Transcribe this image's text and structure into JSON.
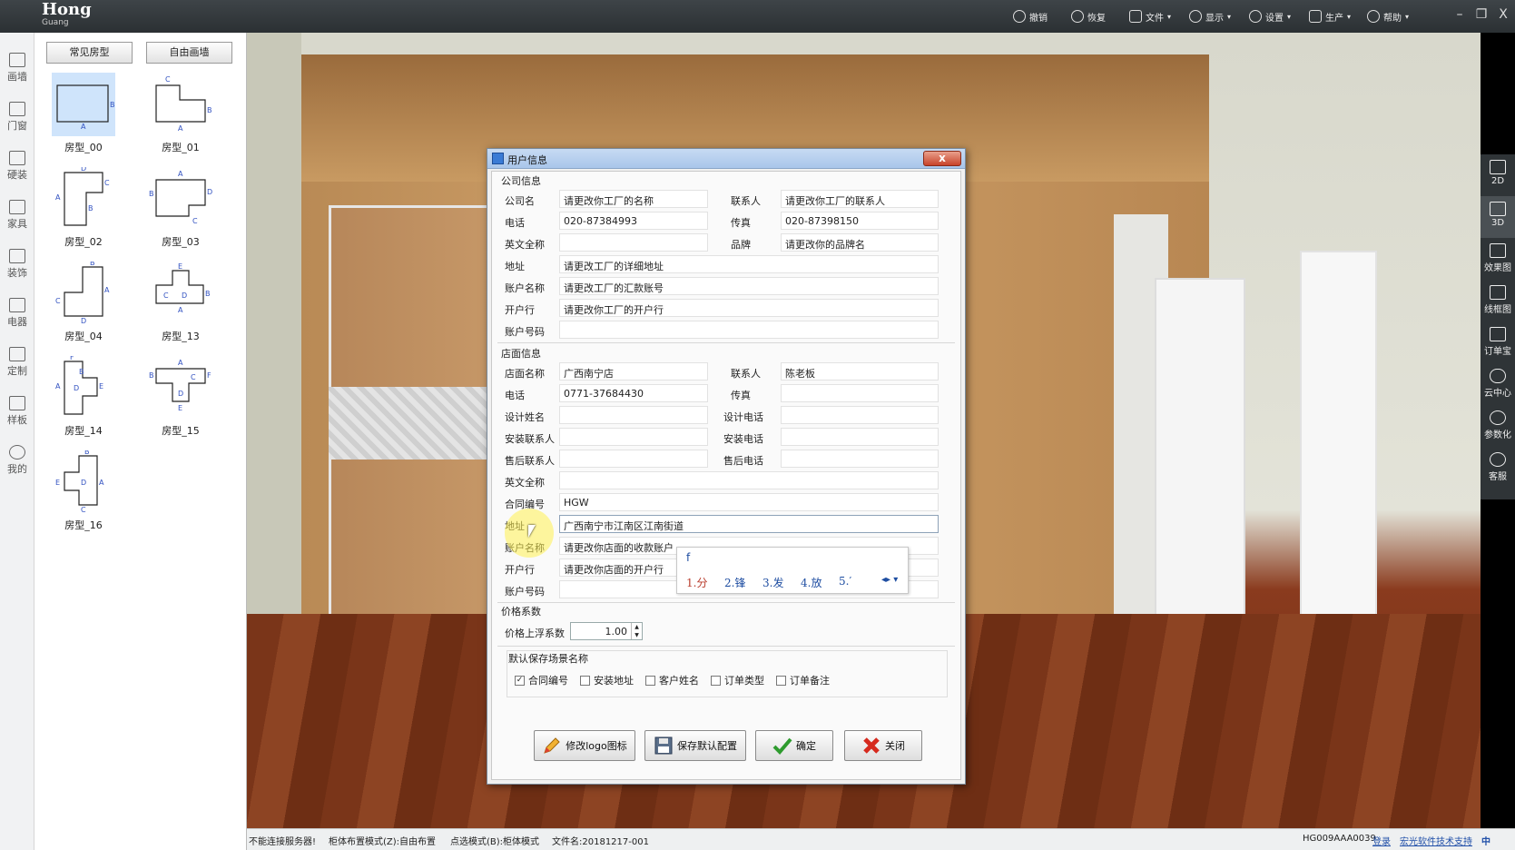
{
  "app": {
    "logo_main": "Hong",
    "logo_sub": "Guang"
  },
  "toolbar": {
    "undo": "撤销",
    "redo": "恢复",
    "file": "文件",
    "display": "显示",
    "settings": "设置",
    "produce": "生产",
    "help": "帮助"
  },
  "window_controls": {
    "minimize": "–",
    "restore": "❐",
    "close": "X"
  },
  "rail": [
    "画墙",
    "门窗",
    "硬装",
    "家具",
    "装饰",
    "电器",
    "定制",
    "样板",
    "我的"
  ],
  "panel": {
    "tab_common": "常见房型",
    "tab_free": "自由画墙",
    "rooms": [
      "房型_00",
      "房型_01",
      "房型_02",
      "房型_03",
      "房型_04",
      "房型_13",
      "房型_14",
      "房型_15",
      "房型_16"
    ]
  },
  "right_tools": [
    "2D",
    "3D",
    "效果图",
    "线框图",
    "订单宝",
    "云中心",
    "参数化",
    "客服"
  ],
  "dialog": {
    "title": "用户信息",
    "close": "x",
    "company_section": "公司信息",
    "company": {
      "name_label": "公司名",
      "name_value": "请更改你工厂的名称",
      "contact_label": "联系人",
      "contact_value": "请更改你工厂的联系人",
      "phone_label": "电话",
      "phone_value": "020-87384993",
      "fax_label": "传真",
      "fax_value": "020-87398150",
      "en_name_label": "英文全称",
      "en_name_value": "",
      "brand_label": "品牌",
      "brand_value": "请更改你的品牌名",
      "address_label": "地址",
      "address_value": "请更改工厂的详细地址",
      "account_name_label": "账户名称",
      "account_name_value": "请更改工厂的汇款账号",
      "bank_label": "开户行",
      "bank_value": "请更改你工厂的开户行",
      "account_no_label": "账户号码",
      "account_no_value": ""
    },
    "store_section": "店面信息",
    "store": {
      "name_label": "店面名称",
      "name_value": "广西南宁店",
      "contact_label": "联系人",
      "contact_value": "陈老板",
      "phone_label": "电话",
      "phone_value": "0771-37684430",
      "fax_label": "传真",
      "fax_value": "",
      "designer_label": "设计姓名",
      "designer_value": "",
      "designer_phone_label": "设计电话",
      "designer_phone_value": "",
      "install_contact_label": "安装联系人",
      "install_contact_value": "",
      "install_phone_label": "安装电话",
      "install_phone_value": "",
      "aftersale_contact_label": "售后联系人",
      "aftersale_contact_value": "",
      "aftersale_phone_label": "售后电话",
      "aftersale_phone_value": "",
      "en_name_label": "英文全称",
      "en_name_value": "",
      "contract_label": "合同编号",
      "contract_value": "HGW",
      "address_label": "地址",
      "address_value": "广西南宁市江南区江南街道",
      "account_name_label": "账户名称",
      "account_name_value": "请更改你店面的收款账户",
      "bank_label": "开户行",
      "bank_value": "请更改你店面的开户行",
      "account_no_label": "账户号码",
      "account_no_value": ""
    },
    "price_section": "价格系数",
    "price_label": "价格上浮系数",
    "price_value": "1.00",
    "scene_section": "默认保存场景名称",
    "checkboxes": [
      {
        "label": "合同编号",
        "checked": true
      },
      {
        "label": "安装地址",
        "checked": false
      },
      {
        "label": "客户姓名",
        "checked": false
      },
      {
        "label": "订单类型",
        "checked": false
      },
      {
        "label": "订单备注",
        "checked": false
      }
    ],
    "buttons": {
      "logo": "修改logo图标",
      "save_default": "保存默认配置",
      "ok": "确定",
      "close": "关闭"
    }
  },
  "ime": {
    "typed": "f",
    "candidates": [
      "1.分",
      "2.锋",
      "3.发",
      "4.放",
      "5.′"
    ],
    "pager": "◂▸ ▾"
  },
  "status": {
    "server": "不能连接服务器!",
    "layout_mode": "柜体布置模式(Z):自由布置",
    "select_mode": "点选模式(B):柜体模式",
    "filename": "文件名:20181217-001",
    "code": "HG009AAA0039",
    "login": "登录",
    "support": "宏光软件技术支持",
    "ime_indicator": "中"
  },
  "colors": {
    "titlebar": "#2b3033",
    "dialog_title": "#a9c6ea",
    "close_red": "#c8432a",
    "selected_room": "#cfe4fb"
  }
}
